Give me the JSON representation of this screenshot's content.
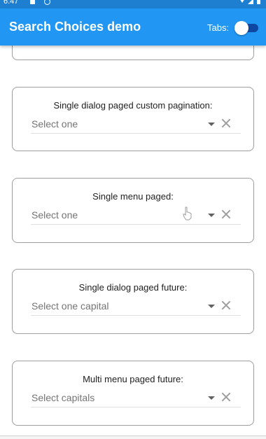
{
  "status_bar": {
    "time": "6:47"
  },
  "app_bar": {
    "title": "Search Choices demo",
    "tabs_label": "Tabs:"
  },
  "cards": [
    {
      "label": "Single dialog paged custom pagination:",
      "hint": "Select one"
    },
    {
      "label": "Single menu paged:",
      "hint": "Select one"
    },
    {
      "label": "Single dialog paged future:",
      "hint": "Select one capital"
    },
    {
      "label": "Multi menu paged future:",
      "hint": "Select capitals"
    }
  ],
  "colors": {
    "app_bar": "#2196f3",
    "status_bar": "#1e7fd0",
    "switch_track": "#0d47a1"
  },
  "tabs_switch": {
    "on": false
  }
}
